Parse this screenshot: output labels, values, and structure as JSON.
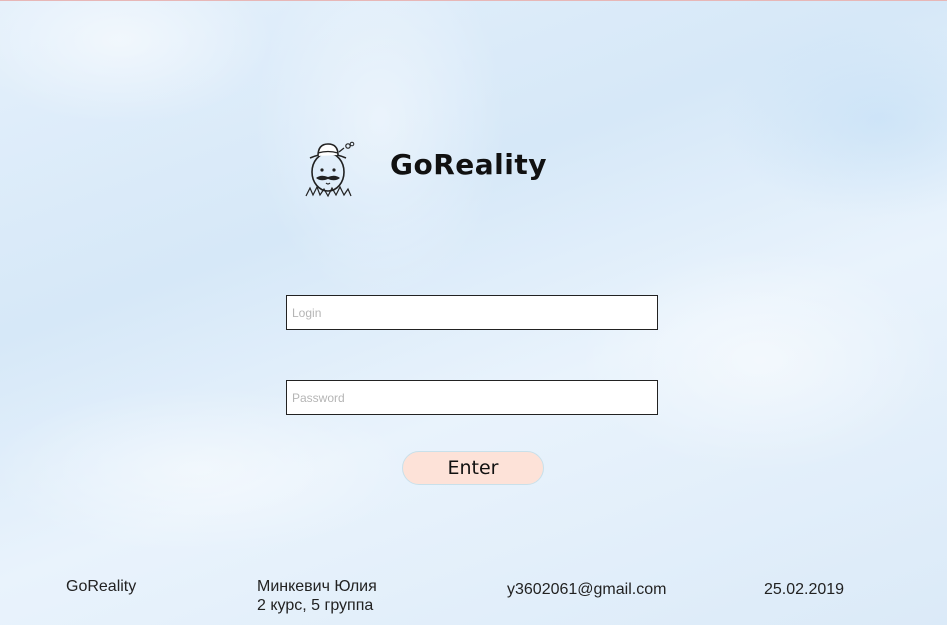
{
  "app": {
    "brand_name": "GoReality",
    "logo_icon": "mustached-egg-with-hat-icon"
  },
  "form": {
    "login_placeholder": "Login",
    "login_value": "",
    "password_placeholder": "Password",
    "password_value": "",
    "enter_label": "Enter"
  },
  "footer": {
    "brand": "GoReality",
    "author_name": "Минкевич Юлия",
    "author_group": "2 курс, 5 группа",
    "email": "y3602061@gmail.com",
    "date": "25.02.2019"
  },
  "colors": {
    "button_bg": "#fde2d8",
    "background": "#dbeaf8"
  }
}
